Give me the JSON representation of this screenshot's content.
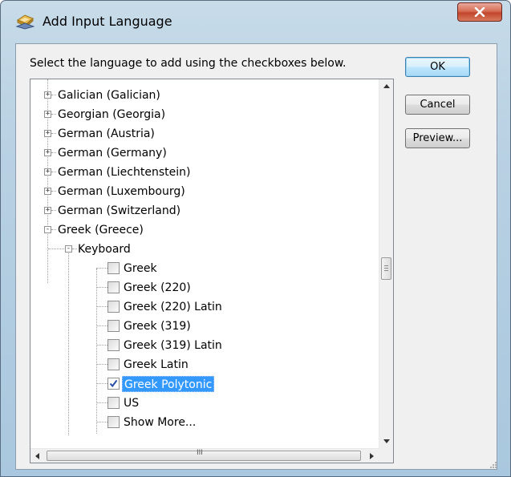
{
  "window": {
    "title": "Add Input Language",
    "close_glyph": "X"
  },
  "dialog": {
    "prompt": "Select the language to add using the checkboxes below."
  },
  "buttons": {
    "ok": "OK",
    "cancel": "Cancel",
    "preview": "Preview..."
  },
  "tree": {
    "languages": [
      {
        "label": "Galician (Galician)",
        "expander": "+"
      },
      {
        "label": "Georgian (Georgia)",
        "expander": "+"
      },
      {
        "label": "German (Austria)",
        "expander": "+"
      },
      {
        "label": "German (Germany)",
        "expander": "+"
      },
      {
        "label": "German (Liechtenstein)",
        "expander": "+"
      },
      {
        "label": "German (Luxembourg)",
        "expander": "+"
      },
      {
        "label": "German (Switzerland)",
        "expander": "+"
      },
      {
        "label": "Greek (Greece)",
        "expander": "-"
      }
    ],
    "keyboard": {
      "label": "Keyboard",
      "expander": "-"
    },
    "layouts": [
      {
        "label": "Greek",
        "checked": false
      },
      {
        "label": "Greek (220)",
        "checked": false
      },
      {
        "label": "Greek (220) Latin",
        "checked": false
      },
      {
        "label": "Greek (319)",
        "checked": false
      },
      {
        "label": "Greek (319) Latin",
        "checked": false
      },
      {
        "label": "Greek Latin",
        "checked": false
      },
      {
        "label": "Greek Polytonic",
        "checked": true,
        "selected": true
      },
      {
        "label": "US",
        "checked": false
      },
      {
        "label": "Show More...",
        "checked": false
      }
    ]
  },
  "scrollbars": {
    "vertical_thumb_position": 0.47,
    "horizontal_thumb_position": 0.0,
    "thumb_grip_glyph": "III"
  },
  "colors": {
    "selection": "#3399ff",
    "titlebar": "#b9d1e3",
    "close_button": "#c2452a"
  }
}
